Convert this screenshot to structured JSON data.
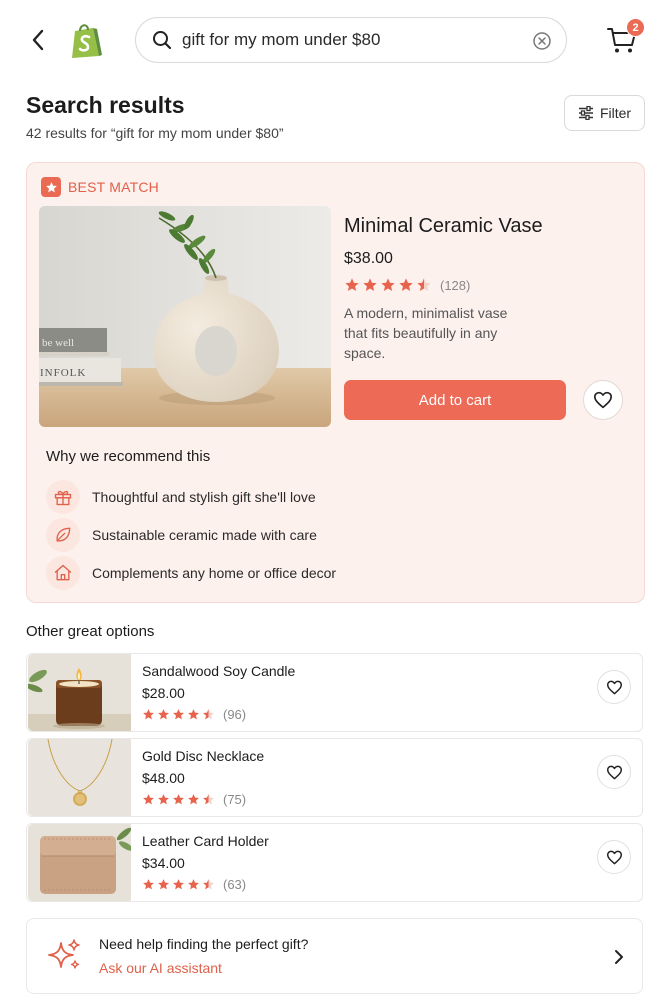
{
  "header": {
    "search": {
      "value": "gift for my mom under $80",
      "placeholder": "Search"
    },
    "cart_count": "2"
  },
  "results": {
    "title": "Search results",
    "subtitle": "42 results for “gift for my mom under $80”",
    "filter_label": "Filter"
  },
  "best_match": {
    "badge": "BEST MATCH",
    "name": "Minimal Ceramic Vase",
    "price": "$38.00",
    "rating": 4.5,
    "rating_count": "(128)",
    "description": "A modern, minimalist vase that fits beautifully in any space.",
    "add_to_cart": "Add to cart",
    "book_text_1": "be well",
    "book_text_2": "INFOLK",
    "why_title": "Why we recommend this",
    "reasons": [
      {
        "icon": "gift-icon",
        "text": "Thoughtful and stylish gift she'll love"
      },
      {
        "icon": "leaf-icon",
        "text": "Sustainable ceramic made with care"
      },
      {
        "icon": "home-icon",
        "text": "Complements any home or office decor"
      }
    ]
  },
  "other": {
    "title": "Other great options",
    "items": [
      {
        "name": "Sandalwood Soy Candle",
        "price": "$28.00",
        "rating": 4.5,
        "rating_count": "(96)",
        "thumb": "candle"
      },
      {
        "name": "Gold Disc Necklace",
        "price": "$48.00",
        "rating": 4.5,
        "rating_count": "(75)",
        "thumb": "necklace"
      },
      {
        "name": "Leather Card Holder",
        "price": "$34.00",
        "rating": 4.5,
        "rating_count": "(63)",
        "thumb": "cardholder"
      }
    ]
  },
  "assistant": {
    "question": "Need help finding the perfect gift?",
    "link": "Ask our AI assistant"
  },
  "colors": {
    "accent": "#ea6a54",
    "card_bg": "#fdf1ee",
    "star": "#e8634e"
  }
}
